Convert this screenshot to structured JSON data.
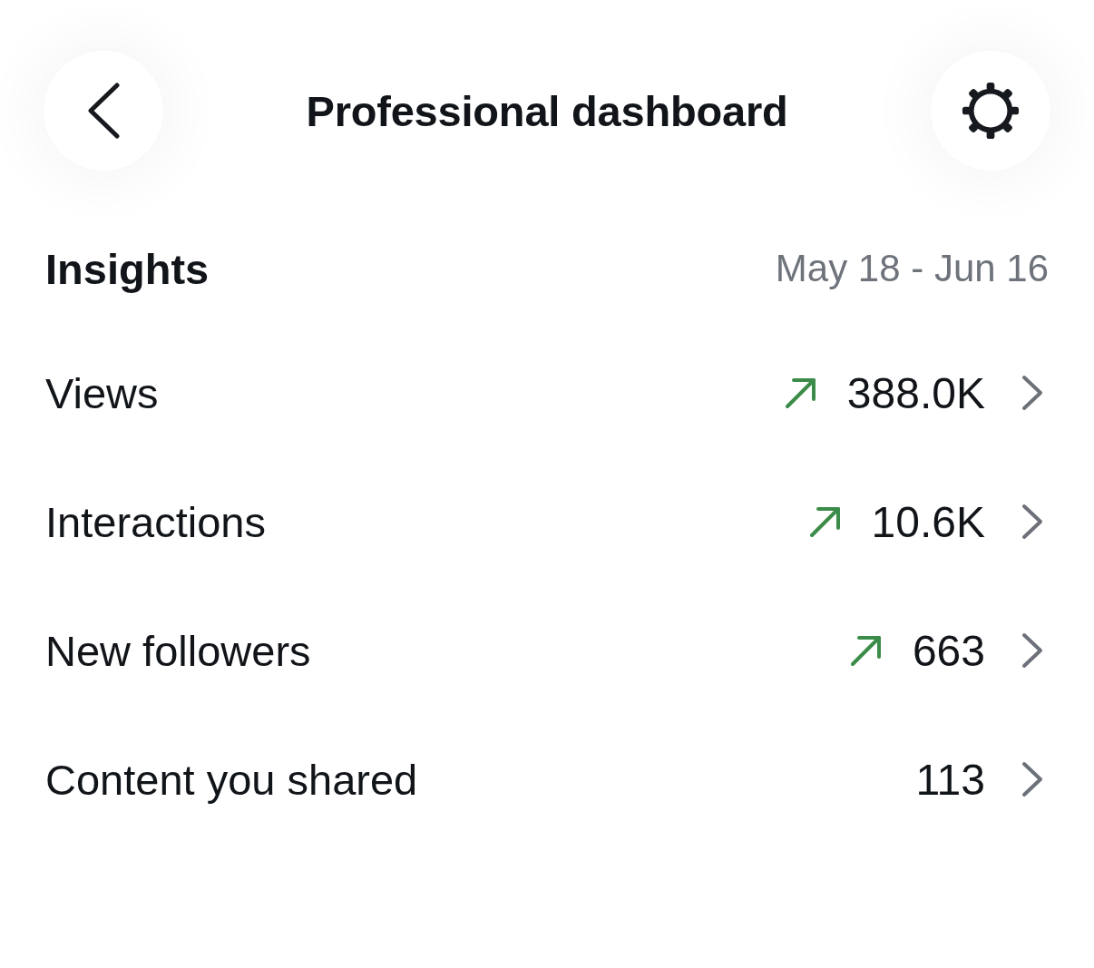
{
  "header": {
    "title": "Professional dashboard"
  },
  "insights": {
    "title": "Insights",
    "date_range": "May 18 - Jun 16"
  },
  "metrics": [
    {
      "label": "Views",
      "value": "388.0K",
      "trending_up": true
    },
    {
      "label": "Interactions",
      "value": "10.6K",
      "trending_up": true
    },
    {
      "label": "New followers",
      "value": "663",
      "trending_up": true
    },
    {
      "label": "Content you shared",
      "value": "113",
      "trending_up": false
    }
  ]
}
